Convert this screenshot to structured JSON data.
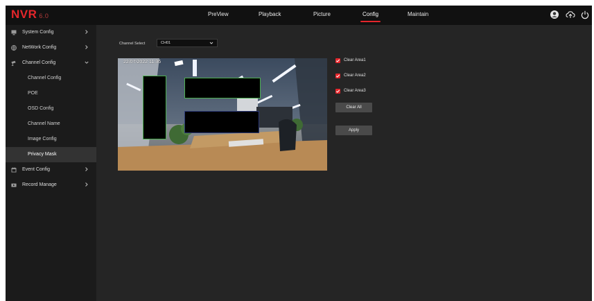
{
  "app": {
    "logo_text": "NVR",
    "logo_version": "6.0"
  },
  "topnav": [
    {
      "label": "PreView"
    },
    {
      "label": "Playback"
    },
    {
      "label": "Picture"
    },
    {
      "label": "Config",
      "active": true
    },
    {
      "label": "Maintain"
    }
  ],
  "header_icons": [
    "user-avatar-icon",
    "cloud-upload-icon",
    "power-icon"
  ],
  "sidebar": {
    "system_config": {
      "label": "System Config",
      "icon": "monitor-icon"
    },
    "network_config": {
      "label": "NetWork Config",
      "icon": "globe-icon"
    },
    "channel_config": {
      "label": "Channel Config",
      "icon": "camera-icon",
      "expanded": true,
      "children": [
        {
          "label": "Channel Config"
        },
        {
          "label": "POE"
        },
        {
          "label": "OSD Config"
        },
        {
          "label": "Channel Name"
        },
        {
          "label": "Image Config"
        },
        {
          "label": "Privacy Mask",
          "active": true
        }
      ]
    },
    "event_config": {
      "label": "Event Config",
      "icon": "calendar-icon"
    },
    "record_manage": {
      "label": "Record Manage",
      "icon": "video-icon"
    }
  },
  "main": {
    "channel_select_label": "Channel Select",
    "channel_select_value": "CH01",
    "osd_timestamp": "22/07/2022  11:36",
    "clear_areas": [
      {
        "label": "Clear Area1",
        "checked": true
      },
      {
        "label": "Clear Area2",
        "checked": true
      },
      {
        "label": "Clear Area3",
        "checked": true
      }
    ],
    "clear_all_label": "Clear All",
    "apply_label": "Apply"
  },
  "colors": {
    "accent": "#e4262b",
    "background": "#252525",
    "sidebar": "#1b1b1b",
    "topbar": "#111111",
    "mask_border": "#4caf50"
  }
}
